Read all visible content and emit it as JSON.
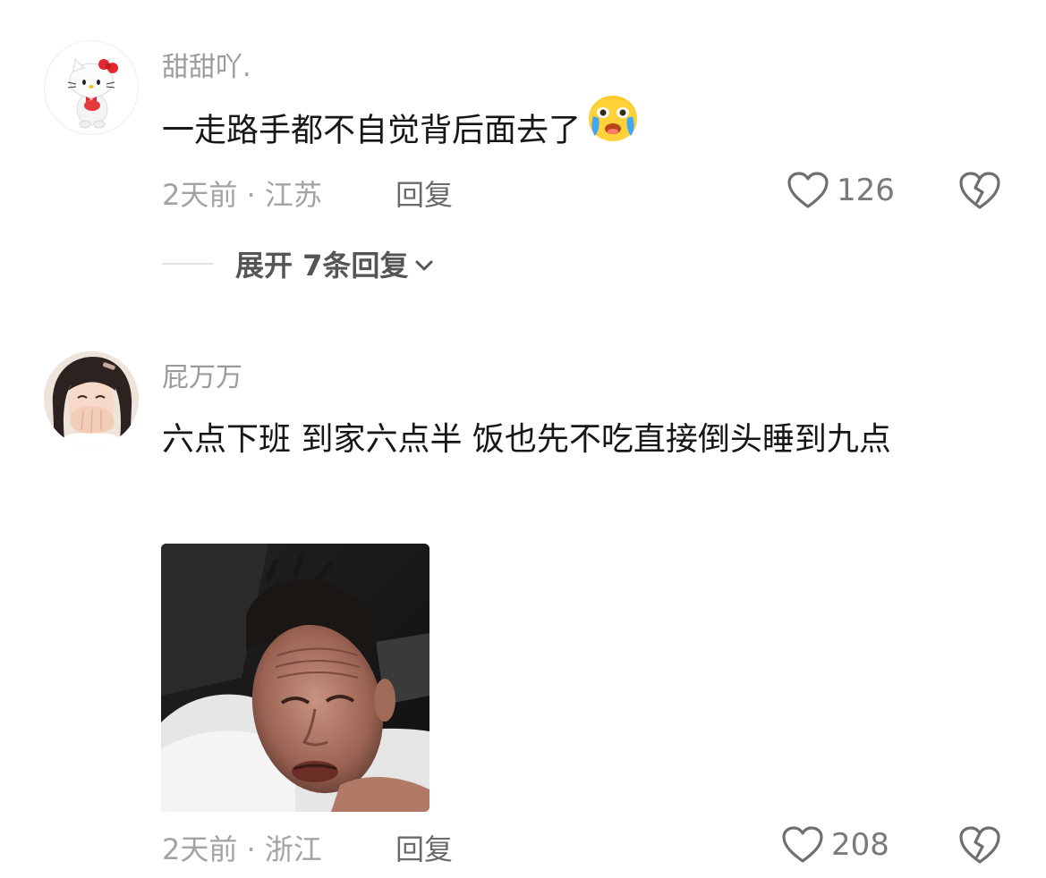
{
  "comments": [
    {
      "username": "甜甜吖.",
      "text": "一走路手都不自觉背后面去了",
      "emoji": "crying-emoji",
      "meta": "2天前 · 江苏",
      "reply_label": "回复",
      "likes": "126",
      "expand_label": "展开 7条回复"
    },
    {
      "username": "屁万万",
      "text": "六点下班 到家六点半 饭也先不吃直接倒头睡到九点",
      "meta": "2天前 · 浙江",
      "reply_label": "回复",
      "likes": "208"
    }
  ],
  "colors": {
    "username": "#9b9b9b",
    "text": "#161616",
    "meta": "#a3a3a3",
    "reply": "#6a6a6a",
    "icon": "#7a7a7a"
  }
}
